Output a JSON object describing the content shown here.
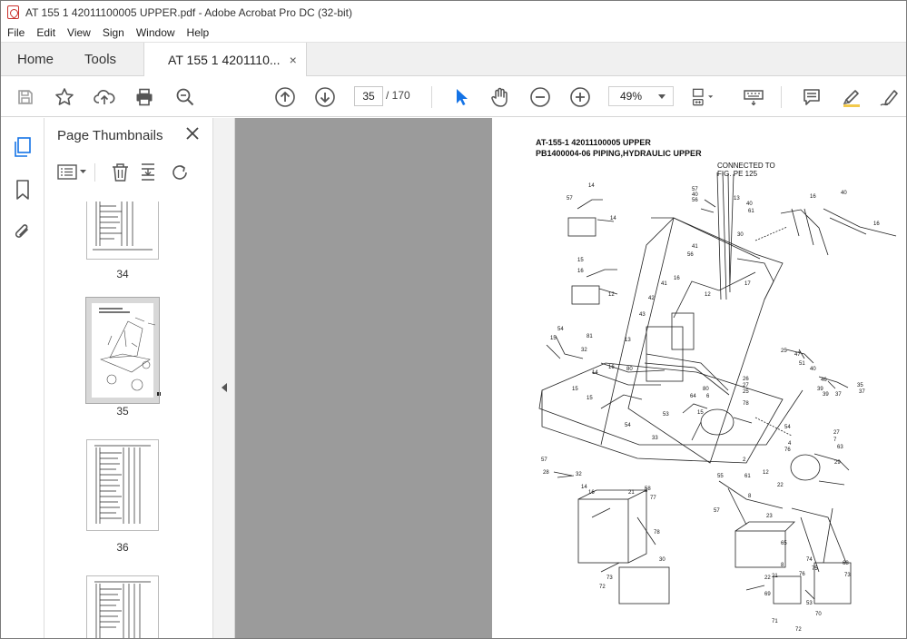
{
  "window": {
    "title": "AT 155 1 42011100005 UPPER.pdf - Adobe Acrobat Pro DC (32-bit)"
  },
  "menu": [
    "File",
    "Edit",
    "View",
    "Sign",
    "Window",
    "Help"
  ],
  "tabs": {
    "home": "Home",
    "tools": "Tools",
    "document": "AT 155 1 4201110...",
    "close_glyph": "×"
  },
  "toolbar": {
    "current_page": "35",
    "page_total": "/  170",
    "zoom": "49%"
  },
  "thumbnails_panel": {
    "title": "Page Thumbnails",
    "close_glyph": "✕",
    "pages": [
      {
        "label": "34",
        "selected": false
      },
      {
        "label": "35",
        "selected": true
      },
      {
        "label": "36",
        "selected": false
      },
      {
        "label": "",
        "selected": false
      }
    ]
  },
  "document_page": {
    "title_line1": "AT-155-1 42011100005 UPPER",
    "title_line2": "PB1400004-06 PIPING,HYDRAULIC UPPER",
    "note_line1": "CONNECTED TO",
    "note_line2": "FIG. PE 125",
    "callouts": [
      "57",
      "14",
      "14",
      "16",
      "16",
      "16",
      "40",
      "16",
      "57",
      "40",
      "56",
      "13",
      "40",
      "61",
      "30",
      "15",
      "15",
      "41",
      "56",
      "42",
      "41",
      "12",
      "16",
      "12",
      "17",
      "54",
      "15",
      "81",
      "32",
      "43",
      "13",
      "80",
      "18",
      "16",
      "14",
      "15",
      "15",
      "80",
      "26",
      "27",
      "25",
      "47",
      "51",
      "40",
      "46",
      "39",
      "35",
      "37",
      "39",
      "39",
      "37",
      "64",
      "6",
      "78",
      "54",
      "27",
      "7",
      "76",
      "63",
      "4",
      "29",
      "53",
      "54",
      "33",
      "15",
      "57",
      "28",
      "32",
      "14",
      "3",
      "77",
      "16",
      "2",
      "12",
      "22",
      "61",
      "21",
      "78",
      "58",
      "55",
      "30",
      "8",
      "23",
      "65",
      "72",
      "73",
      "57",
      "22",
      "21",
      "8",
      "74",
      "75",
      "70",
      "71",
      "69",
      "73",
      "72",
      "53",
      "76",
      "68"
    ]
  }
}
